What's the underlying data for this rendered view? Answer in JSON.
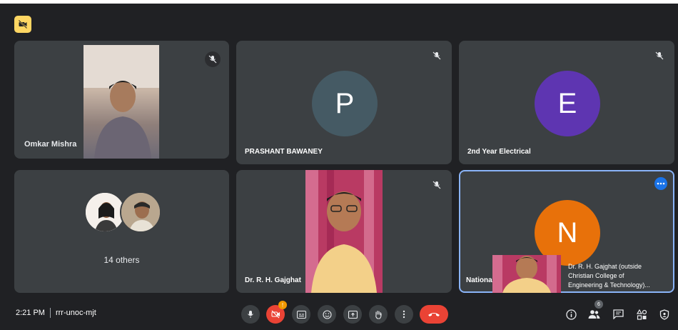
{
  "colors": {
    "background": "#202124",
    "tile": "#3c4043",
    "avatar_p": "#455a64",
    "avatar_e": "#5e35b1",
    "avatar_n": "#e8710a",
    "active_border": "#8ab4f8",
    "hangup": "#ea4335",
    "badge": "#fdd663"
  },
  "participants": [
    {
      "name": "Omkar Mishra",
      "type": "video",
      "muted": true
    },
    {
      "name": "PRASHANT BAWANEY",
      "initial": "P",
      "muted": true
    },
    {
      "name": "2nd Year Electrical",
      "initial": "E",
      "muted": true
    },
    {
      "name": "14 others",
      "type": "group"
    },
    {
      "name": "Dr. R. H. Gajghat",
      "type": "video",
      "muted": true
    },
    {
      "name": "Nationa",
      "initial": "N",
      "active": true
    }
  ],
  "pip": {
    "caption_line1": "Dr. R. H. Gajghat (outside",
    "caption_line2": "Christian College of",
    "caption_line3": "Engineering & Technology)..."
  },
  "bottom_bar": {
    "time": "2:21 PM",
    "meeting_code": "rrr-unoc-mjt",
    "camera_badge": "!",
    "people_count": "6",
    "controls": [
      "mic-icon",
      "camera-off-icon",
      "captions-icon",
      "emoji-icon",
      "present-icon",
      "raise-hand-icon",
      "more-options-icon",
      "hang-up-icon"
    ],
    "right_icons": [
      "info-icon",
      "people-icon",
      "chat-icon",
      "activities-icon",
      "host-controls-icon"
    ]
  }
}
